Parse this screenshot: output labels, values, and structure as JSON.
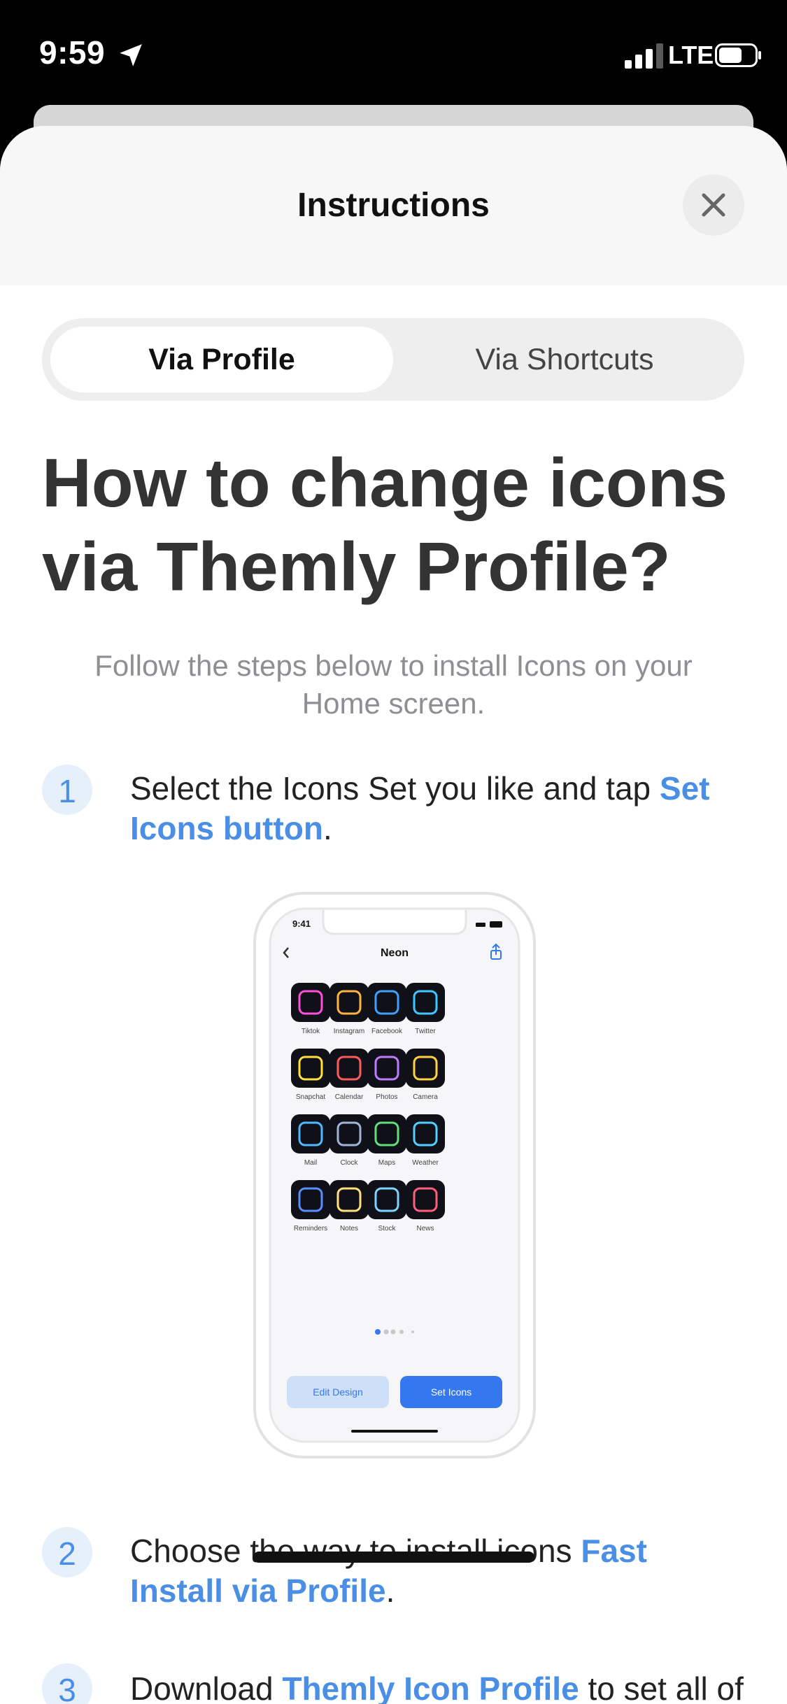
{
  "status_bar": {
    "time": "9:59",
    "network": "LTE"
  },
  "sheet": {
    "title": "Instructions"
  },
  "segments": {
    "active": "Via Profile",
    "inactive": "Via Shortcuts"
  },
  "headline": {
    "line1": "How to change icons",
    "line2": "via Themly Profile?"
  },
  "subtitle": {
    "line1": "Follow the steps below to install Icons on your",
    "line2": "Home screen."
  },
  "steps": [
    {
      "number": "1",
      "text": "Select the Icons Set you like and tap ",
      "link": "Set Icons button",
      "after": "."
    },
    {
      "number": "2",
      "text": "Choose the way to install icons ",
      "link": "Fast Install via Profile",
      "after": "."
    },
    {
      "number": "3",
      "text": "Download ",
      "link": "Themly Icon Profile",
      "after": " to set all of"
    }
  ],
  "preview": {
    "time": "9:41",
    "title": "Neon",
    "icons": [
      "Tiktok",
      "Instagram",
      "Facebook",
      "Twitter",
      "Snapchat",
      "Calendar",
      "Photos",
      "Camera",
      "Mail",
      "Clock",
      "Maps",
      "Weather",
      "Reminders",
      "Notes",
      "Stock",
      "News"
    ],
    "buttons": {
      "edit": "Edit Design",
      "set": "Set Icons"
    }
  },
  "colors": {
    "accent": "#4a8fe5",
    "button_blue": "#3577ee",
    "button_light": "#cde0f8",
    "heading": "#333333"
  },
  "icons_semantic": [
    "location-arrow-icon",
    "signal-icon",
    "battery-icon",
    "close-icon",
    "share-icon",
    "back-chevron-icon"
  ]
}
